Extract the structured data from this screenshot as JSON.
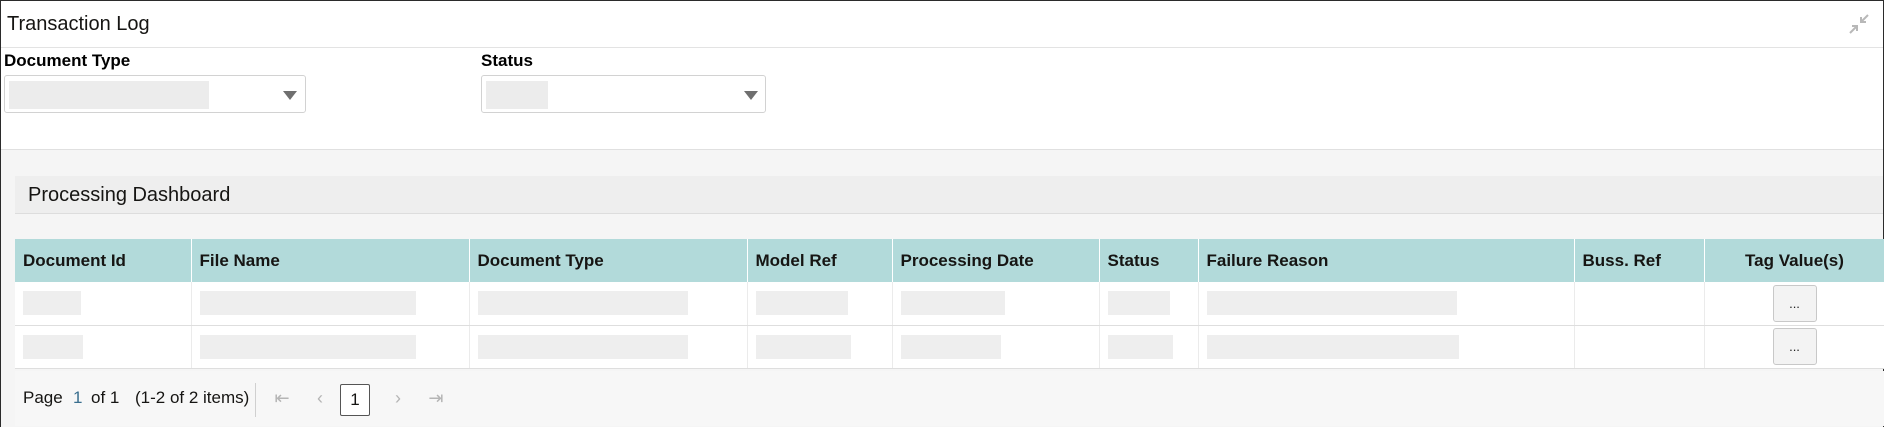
{
  "window": {
    "title": "Transaction Log"
  },
  "filters": {
    "document_type": {
      "label": "Document Type"
    },
    "status": {
      "label": "Status"
    }
  },
  "dashboard": {
    "title": "Processing Dashboard",
    "columns": [
      "Document Id",
      "File Name",
      "Document Type",
      "Model Ref",
      "Processing Date",
      "Status",
      "Failure Reason",
      "Buss. Ref",
      "Tag Value(s)"
    ],
    "rows": [
      {
        "tag_button": "..."
      },
      {
        "tag_button": "..."
      }
    ]
  },
  "pagination": {
    "page_label": "Page",
    "current": "1",
    "of_label": "of 1",
    "items_summary": "(1-2 of 2 items)",
    "page_button": "1"
  },
  "icons": {
    "collapse": "collapse-icon",
    "first": "first-page-icon",
    "prev": "prev-page-icon",
    "next": "next-page-icon",
    "last": "last-page-icon"
  },
  "colors": {
    "header_bg": "#b2dada",
    "panel_bg": "#f5f5f5"
  }
}
